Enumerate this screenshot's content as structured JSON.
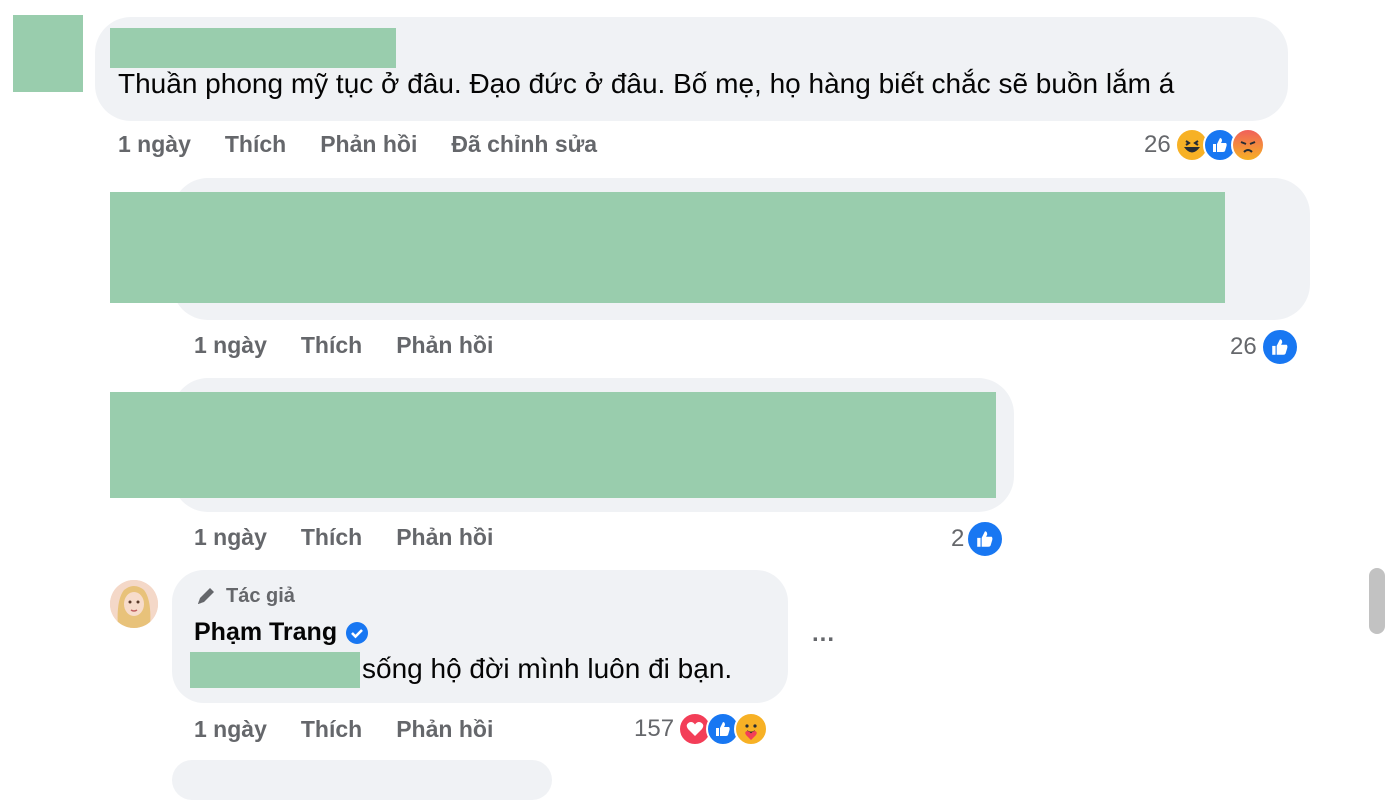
{
  "comments": [
    {
      "text": "Thuần phong mỹ tục ở đâu. Đạo đức ở đâu. Bố mẹ, họ hàng biết chắc sẽ buồn lắm á",
      "time": "1 ngày",
      "like": "Thích",
      "reply": "Phản hồi",
      "edited": "Đã chỉnh sửa",
      "reaction_count": "26",
      "reactions": [
        "haha-icon",
        "like-icon",
        "angry-icon"
      ]
    },
    {
      "time": "1 ngày",
      "like": "Thích",
      "reply": "Phản hồi",
      "reaction_count": "26",
      "reactions": [
        "like-icon"
      ]
    },
    {
      "time": "1 ngày",
      "like": "Thích",
      "reply": "Phản hồi",
      "reaction_count": "2",
      "reactions": [
        "like-icon"
      ]
    },
    {
      "author_badge": "Tác giả",
      "author_name": "Phạm Trang",
      "text": "sống hộ đời mình luôn đi bạn.",
      "time": "1 ngày",
      "like": "Thích",
      "reply": "Phản hồi",
      "reaction_count": "157",
      "reactions": [
        "love-icon",
        "like-icon",
        "care-icon"
      ],
      "more_label": "..."
    }
  ],
  "colors": {
    "bubble": "#f0f2f5",
    "redaction": "#99cdad",
    "meta_text": "#65676b",
    "like_blue": "#1877f2",
    "verified_blue": "#1877f2"
  }
}
